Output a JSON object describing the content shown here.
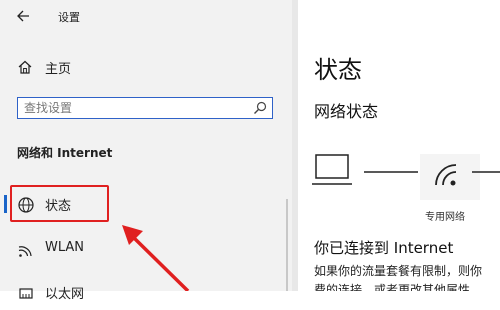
{
  "window": {
    "title": "设置"
  },
  "sidebar": {
    "home_label": "主页",
    "search": {
      "placeholder": "查找设置"
    },
    "section_title": "网络和 Internet",
    "items": [
      {
        "label": "状态",
        "icon": "globe-icon",
        "selected": true
      },
      {
        "label": "WLAN",
        "icon": "wifi-icon",
        "selected": false
      },
      {
        "label": "以太网",
        "icon": "ethernet-icon",
        "selected": false
      }
    ]
  },
  "main": {
    "title": "状态",
    "section": "网络状态",
    "network_label": "专用网络",
    "connected_heading": "你已连接到 Internet",
    "description_lines": [
      "如果你的流量套餐有限制，则你",
      "费的连接，或者更改其他属性"
    ]
  },
  "colors": {
    "accent": "#1a64c8",
    "annotation_red": "#e02020",
    "sidebar_bg": "#f2f2f2"
  }
}
